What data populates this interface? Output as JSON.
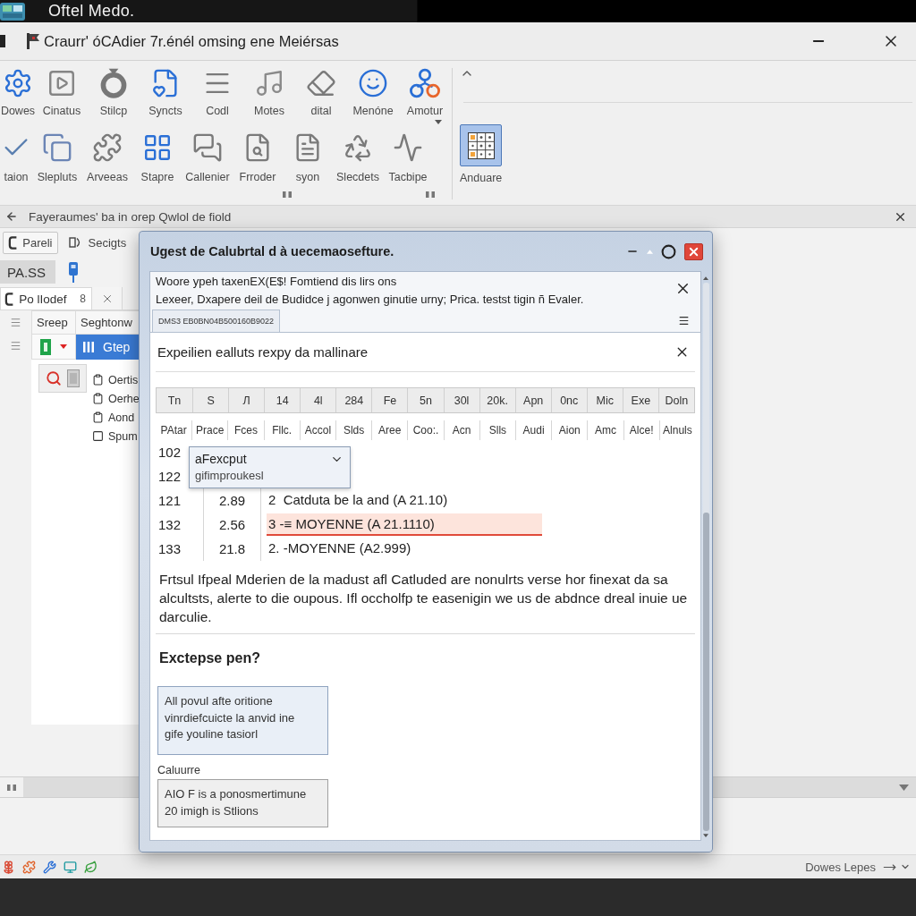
{
  "top_bar": {
    "title": "Oftel Medo."
  },
  "window": {
    "title": "Craurr' óCAdier 7r.énél omsing ene Meiérsas"
  },
  "ribbon": {
    "row_1": [
      {
        "label": "Dowes",
        "menu": false
      },
      {
        "label": "Cinatus",
        "menu": false
      },
      {
        "label": "Stilcp",
        "menu": false
      },
      {
        "label": "Syncts",
        "menu": false
      },
      {
        "label": "Codl",
        "menu": false
      },
      {
        "label": "Motes",
        "menu": false
      },
      {
        "label": "dital",
        "menu": false
      },
      {
        "label": "Menóne",
        "menu": false
      },
      {
        "label": "Amotur",
        "menu": true
      }
    ],
    "row_2": [
      {
        "label": "taion"
      },
      {
        "label": "Slepluts"
      },
      {
        "label": "Arveeas"
      },
      {
        "label": "Stapre"
      },
      {
        "label": "Callenier"
      },
      {
        "label": "Frroder"
      },
      {
        "label": "syon"
      },
      {
        "label": "Slecdets"
      },
      {
        "label": "Tacbipe"
      }
    ],
    "side": {
      "label": "Anduare",
      "selected": true
    }
  },
  "info_bar": {
    "message": "Fayeraumes' ba in orep Qwlol de fiold"
  },
  "left_panel": {
    "toolbar": [
      {
        "label": "Pareli",
        "kind": "framed"
      },
      {
        "label": "Secigts",
        "kind": "plain"
      }
    ],
    "section": {
      "label": "PA.SS"
    },
    "doc_tab": {
      "label": "Po lIodef",
      "badge": "8"
    },
    "tree": {
      "columns": [
        "Sreep",
        "Seghtonw"
      ],
      "nodes": [
        {
          "label": "Gtep",
          "selected": true
        }
      ],
      "items": [
        {
          "label": "Oertis",
          "kind": "clipboard"
        },
        {
          "label": "Oerhe",
          "kind": "clipboard"
        },
        {
          "label": "Aond",
          "kind": "clipboard"
        },
        {
          "label": "Spum",
          "kind": "square"
        }
      ]
    }
  },
  "dialog": {
    "title": "Ugest de Calubrtal d à uecemaosefture.",
    "notice": {
      "lines": [
        "Woore ypeh taxenEX(E$! Fomtiend dis lirs ons",
        "Lexeer, Dxapere deil de Budidce j agonwen ginutie urny; Prica. testst tigin ñ Evaler."
      ],
      "tab": "DMS3 EB0BN04B500160B9022"
    },
    "panel": {
      "title": "Expeilien ealluts rexpy da mallinare",
      "table": {
        "columns": [
          "Tn",
          "S",
          "Л",
          "14",
          "4l",
          "284",
          "Fe",
          "5n",
          "30l",
          "20k.",
          "Apn",
          "0nc",
          "Mic",
          "Exe",
          "Doln"
        ],
        "subheaders": [
          "PAtar",
          "Prace",
          "Fces",
          "Fllc.",
          "Accol",
          "Slds",
          "Aree",
          "Coo:.",
          "Acn",
          "Slls",
          "Audi",
          "Aion",
          "Amc",
          "Alce!",
          "Alnuls"
        ],
        "rows": [
          {
            "number": "102",
            "selected": false
          },
          {
            "number": "122",
            "selected": false
          },
          {
            "number": "121",
            "value": "2.89",
            "formula": "2  Catduta be la and (A 21.10)",
            "selected": false
          },
          {
            "number": "132",
            "value": "2.56",
            "formula": "3 -≡ MOYENNE (A 21.1110)",
            "selected": true
          },
          {
            "number": "133",
            "value": "21.8",
            "formula": "2. -MOYENNE (A2.999)",
            "selected": false
          }
        ]
      },
      "dropdown": {
        "value": "aFexcput",
        "detail": "gifimproukesl"
      },
      "description": "Frtsul Ifpeal Mderien de la madust afl Catluded are nonulrts verse hor finexat da sa alcultsts, alerte to die oupous. Ifl occholfp te easenigin we us de abdnce dreal inuie ue darculie.",
      "question": "Exctepse pen?",
      "answer_box": {
        "value": "All povul afte oritione vinrdiefcuicte la anvid ine gife youline tasiorl"
      },
      "field": {
        "label": "Caluurre",
        "value": "AIO F is a ponosmertimune 20 imigh is Stlions"
      }
    }
  },
  "status_bar": {
    "text": "Dowes Lepes"
  }
}
